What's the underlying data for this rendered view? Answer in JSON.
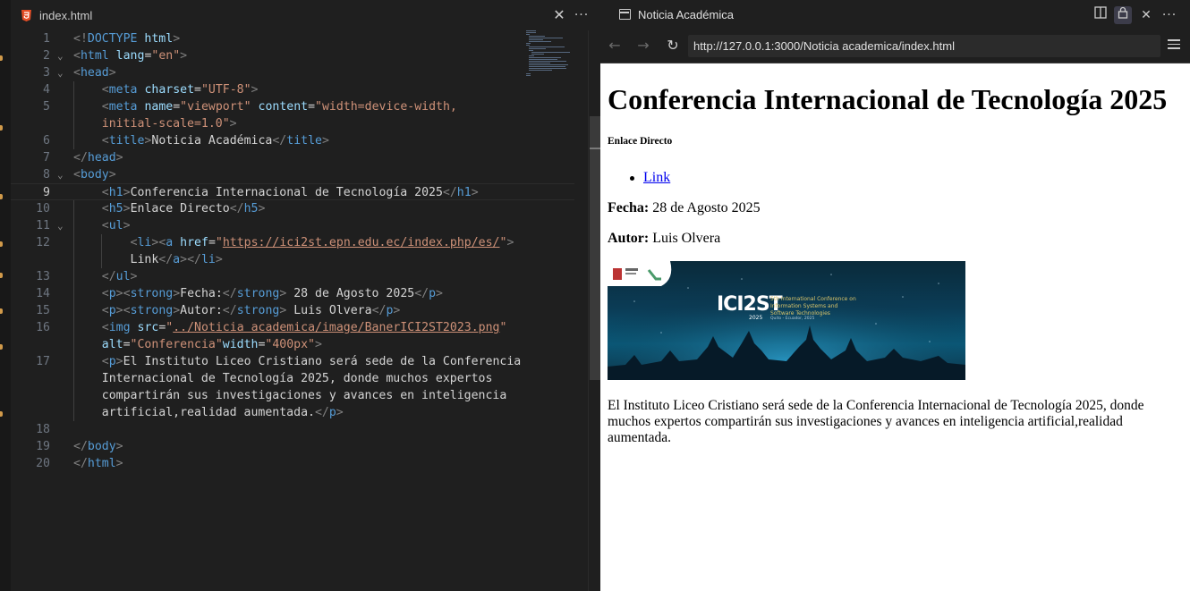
{
  "editor": {
    "tab_title": "index.html",
    "code_lines": [
      {
        "n": "1",
        "fold": "",
        "parts": [
          {
            "c": "t",
            "s": "<!"
          },
          {
            "c": "dt",
            "s": "DOCTYPE"
          },
          {
            "c": "tx",
            "s": " "
          },
          {
            "c": "at",
            "s": "html"
          },
          {
            "c": "t",
            "s": ">"
          }
        ]
      },
      {
        "n": "2",
        "fold": "⌄",
        "parts": [
          {
            "c": "t",
            "s": "<"
          },
          {
            "c": "tn",
            "s": "html"
          },
          {
            "c": "tx",
            "s": " "
          },
          {
            "c": "at",
            "s": "lang"
          },
          {
            "c": "tx",
            "s": "="
          },
          {
            "c": "av",
            "s": "\"en\""
          },
          {
            "c": "t",
            "s": ">"
          }
        ]
      },
      {
        "n": "3",
        "fold": "⌄",
        "parts": [
          {
            "c": "t",
            "s": "<"
          },
          {
            "c": "tn",
            "s": "head"
          },
          {
            "c": "t",
            "s": ">"
          }
        ]
      },
      {
        "n": "4",
        "fold": "",
        "parts": [
          {
            "c": "tx",
            "s": "    "
          },
          {
            "c": "t",
            "s": "<"
          },
          {
            "c": "tn",
            "s": "meta"
          },
          {
            "c": "tx",
            "s": " "
          },
          {
            "c": "at",
            "s": "charset"
          },
          {
            "c": "tx",
            "s": "="
          },
          {
            "c": "av",
            "s": "\"UTF-8\""
          },
          {
            "c": "t",
            "s": ">"
          }
        ]
      },
      {
        "n": "5",
        "fold": "",
        "parts": [
          {
            "c": "tx",
            "s": "    "
          },
          {
            "c": "t",
            "s": "<"
          },
          {
            "c": "tn",
            "s": "meta"
          },
          {
            "c": "tx",
            "s": " "
          },
          {
            "c": "at",
            "s": "name"
          },
          {
            "c": "tx",
            "s": "="
          },
          {
            "c": "av",
            "s": "\"viewport\""
          },
          {
            "c": "tx",
            "s": " "
          },
          {
            "c": "at",
            "s": "content"
          },
          {
            "c": "tx",
            "s": "="
          },
          {
            "c": "av",
            "s": "\"width=device-width,"
          }
        ]
      },
      {
        "n": "",
        "fold": "",
        "parts": [
          {
            "c": "av",
            "s": "    initial-scale=1.0\""
          },
          {
            "c": "t",
            "s": ">"
          }
        ]
      },
      {
        "n": "6",
        "fold": "",
        "parts": [
          {
            "c": "tx",
            "s": "    "
          },
          {
            "c": "t",
            "s": "<"
          },
          {
            "c": "tn",
            "s": "title"
          },
          {
            "c": "t",
            "s": ">"
          },
          {
            "c": "tx",
            "s": "Noticia Académica"
          },
          {
            "c": "t",
            "s": "</"
          },
          {
            "c": "tn",
            "s": "title"
          },
          {
            "c": "t",
            "s": ">"
          }
        ]
      },
      {
        "n": "7",
        "fold": "",
        "parts": [
          {
            "c": "t",
            "s": "</"
          },
          {
            "c": "tn",
            "s": "head"
          },
          {
            "c": "t",
            "s": ">"
          }
        ]
      },
      {
        "n": "8",
        "fold": "⌄",
        "parts": [
          {
            "c": "t",
            "s": "<"
          },
          {
            "c": "tn",
            "s": "body"
          },
          {
            "c": "t",
            "s": ">"
          }
        ]
      },
      {
        "n": "9",
        "fold": "",
        "active": true,
        "parts": [
          {
            "c": "tx",
            "s": "    "
          },
          {
            "c": "t",
            "s": "<"
          },
          {
            "c": "tn",
            "s": "h1"
          },
          {
            "c": "t",
            "s": ">"
          },
          {
            "c": "tx",
            "s": "Conferencia Internacional de Tecnología 2025"
          },
          {
            "c": "t",
            "s": "</"
          },
          {
            "c": "tn",
            "s": "h1"
          },
          {
            "c": "t",
            "s": ">"
          }
        ]
      },
      {
        "n": "10",
        "fold": "",
        "parts": [
          {
            "c": "tx",
            "s": "    "
          },
          {
            "c": "t",
            "s": "<"
          },
          {
            "c": "tn",
            "s": "h5"
          },
          {
            "c": "t",
            "s": ">"
          },
          {
            "c": "tx",
            "s": "Enlace Directo"
          },
          {
            "c": "t",
            "s": "</"
          },
          {
            "c": "tn",
            "s": "h5"
          },
          {
            "c": "t",
            "s": ">"
          }
        ]
      },
      {
        "n": "11",
        "fold": "⌄",
        "parts": [
          {
            "c": "tx",
            "s": "    "
          },
          {
            "c": "t",
            "s": "<"
          },
          {
            "c": "tn",
            "s": "ul"
          },
          {
            "c": "t",
            "s": ">"
          }
        ]
      },
      {
        "n": "12",
        "fold": "",
        "parts": [
          {
            "c": "tx",
            "s": "        "
          },
          {
            "c": "t",
            "s": "<"
          },
          {
            "c": "tn",
            "s": "li"
          },
          {
            "c": "t",
            "s": "><"
          },
          {
            "c": "tn",
            "s": "a"
          },
          {
            "c": "tx",
            "s": " "
          },
          {
            "c": "at",
            "s": "href"
          },
          {
            "c": "tx",
            "s": "="
          },
          {
            "c": "av",
            "s": "\""
          },
          {
            "c": "av ul",
            "s": "https://ici2st.epn.edu.ec/index.php/es/"
          },
          {
            "c": "av",
            "s": "\""
          },
          {
            "c": "t",
            "s": ">"
          }
        ]
      },
      {
        "n": "",
        "fold": "",
        "parts": [
          {
            "c": "tx",
            "s": "        Link"
          },
          {
            "c": "t",
            "s": "</"
          },
          {
            "c": "tn",
            "s": "a"
          },
          {
            "c": "t",
            "s": "></"
          },
          {
            "c": "tn",
            "s": "li"
          },
          {
            "c": "t",
            "s": ">"
          }
        ]
      },
      {
        "n": "13",
        "fold": "",
        "parts": [
          {
            "c": "tx",
            "s": "    "
          },
          {
            "c": "t",
            "s": "</"
          },
          {
            "c": "tn",
            "s": "ul"
          },
          {
            "c": "t",
            "s": ">"
          }
        ]
      },
      {
        "n": "14",
        "fold": "",
        "parts": [
          {
            "c": "tx",
            "s": "    "
          },
          {
            "c": "t",
            "s": "<"
          },
          {
            "c": "tn",
            "s": "p"
          },
          {
            "c": "t",
            "s": "><"
          },
          {
            "c": "tn",
            "s": "strong"
          },
          {
            "c": "t",
            "s": ">"
          },
          {
            "c": "tx",
            "s": "Fecha:"
          },
          {
            "c": "t",
            "s": "</"
          },
          {
            "c": "tn",
            "s": "strong"
          },
          {
            "c": "t",
            "s": ">"
          },
          {
            "c": "tx",
            "s": " 28 de Agosto 2025"
          },
          {
            "c": "t",
            "s": "</"
          },
          {
            "c": "tn",
            "s": "p"
          },
          {
            "c": "t",
            "s": ">"
          }
        ]
      },
      {
        "n": "15",
        "fold": "",
        "parts": [
          {
            "c": "tx",
            "s": "    "
          },
          {
            "c": "t",
            "s": "<"
          },
          {
            "c": "tn",
            "s": "p"
          },
          {
            "c": "t",
            "s": "><"
          },
          {
            "c": "tn",
            "s": "strong"
          },
          {
            "c": "t",
            "s": ">"
          },
          {
            "c": "tx",
            "s": "Autor:"
          },
          {
            "c": "t",
            "s": "</"
          },
          {
            "c": "tn",
            "s": "strong"
          },
          {
            "c": "t",
            "s": ">"
          },
          {
            "c": "tx",
            "s": " Luis Olvera"
          },
          {
            "c": "t",
            "s": "</"
          },
          {
            "c": "tn",
            "s": "p"
          },
          {
            "c": "t",
            "s": ">"
          }
        ]
      },
      {
        "n": "16",
        "fold": "",
        "parts": [
          {
            "c": "tx",
            "s": "    "
          },
          {
            "c": "t",
            "s": "<"
          },
          {
            "c": "tn",
            "s": "img"
          },
          {
            "c": "tx",
            "s": " "
          },
          {
            "c": "at",
            "s": "src"
          },
          {
            "c": "tx",
            "s": "="
          },
          {
            "c": "av",
            "s": "\""
          },
          {
            "c": "av ul",
            "s": "../Noticia academica/image/BanerICI2ST2023.png"
          },
          {
            "c": "av",
            "s": "\""
          }
        ]
      },
      {
        "n": "",
        "fold": "",
        "parts": [
          {
            "c": "tx",
            "s": "    "
          },
          {
            "c": "at",
            "s": "alt"
          },
          {
            "c": "tx",
            "s": "="
          },
          {
            "c": "av",
            "s": "\"Conferencia\""
          },
          {
            "c": "at",
            "s": "width"
          },
          {
            "c": "tx",
            "s": "="
          },
          {
            "c": "av",
            "s": "\"400px\""
          },
          {
            "c": "t",
            "s": ">"
          }
        ]
      },
      {
        "n": "17",
        "fold": "",
        "parts": [
          {
            "c": "tx",
            "s": "    "
          },
          {
            "c": "t",
            "s": "<"
          },
          {
            "c": "tn",
            "s": "p"
          },
          {
            "c": "t",
            "s": ">"
          },
          {
            "c": "tx",
            "s": "El Instituto Liceo Cristiano será sede de la Conferencia"
          }
        ]
      },
      {
        "n": "",
        "fold": "",
        "parts": [
          {
            "c": "tx",
            "s": "    Internacional de Tecnología 2025, donde muchos expertos"
          }
        ]
      },
      {
        "n": "",
        "fold": "",
        "parts": [
          {
            "c": "tx",
            "s": "    compartirán sus investigaciones y avances en inteligencia"
          }
        ]
      },
      {
        "n": "",
        "fold": "",
        "parts": [
          {
            "c": "tx",
            "s": "    artificial,realidad aumentada."
          },
          {
            "c": "t",
            "s": "</"
          },
          {
            "c": "tn",
            "s": "p"
          },
          {
            "c": "t",
            "s": ">"
          }
        ]
      },
      {
        "n": "18",
        "fold": "",
        "parts": []
      },
      {
        "n": "19",
        "fold": "",
        "parts": [
          {
            "c": "t",
            "s": "</"
          },
          {
            "c": "tn",
            "s": "body"
          },
          {
            "c": "t",
            "s": ">"
          }
        ]
      },
      {
        "n": "20",
        "fold": "",
        "parts": [
          {
            "c": "t",
            "s": "</"
          },
          {
            "c": "tn",
            "s": "html"
          },
          {
            "c": "t",
            "s": ">"
          }
        ]
      }
    ]
  },
  "browser": {
    "title": "Noticia Académica",
    "url": "http://127.0.0.1:3000/Noticia academica/index.html",
    "page": {
      "h1": "Conferencia Internacional de Tecnología 2025",
      "h5": "Enlace Directo",
      "link_text": "Link",
      "fecha_label": "Fecha:",
      "fecha_value": " 28 de Agosto 2025",
      "autor_label": "Autor:",
      "autor_value": " Luis Olvera",
      "banner": {
        "logo": "ICI2ST",
        "year": "2025",
        "line1": "5th International Conference on",
        "line2": "Information Systems and",
        "line3": "Software Technologies",
        "place": "Quito - Ecuador, 2025"
      },
      "paragraph": "El Instituto Liceo Cristiano será sede de la Conferencia Internacional de Tecnología 2025, donde muchos expertos compartirán sus investigaciones y avances en inteligencia artificial,realidad aumentada."
    }
  },
  "colors": {
    "editor_bg": "#1f1f1f",
    "tag": "#569cd6",
    "attr": "#9cdcfe",
    "string": "#ce9178",
    "bracket": "#808080",
    "link": "#0000ee"
  }
}
